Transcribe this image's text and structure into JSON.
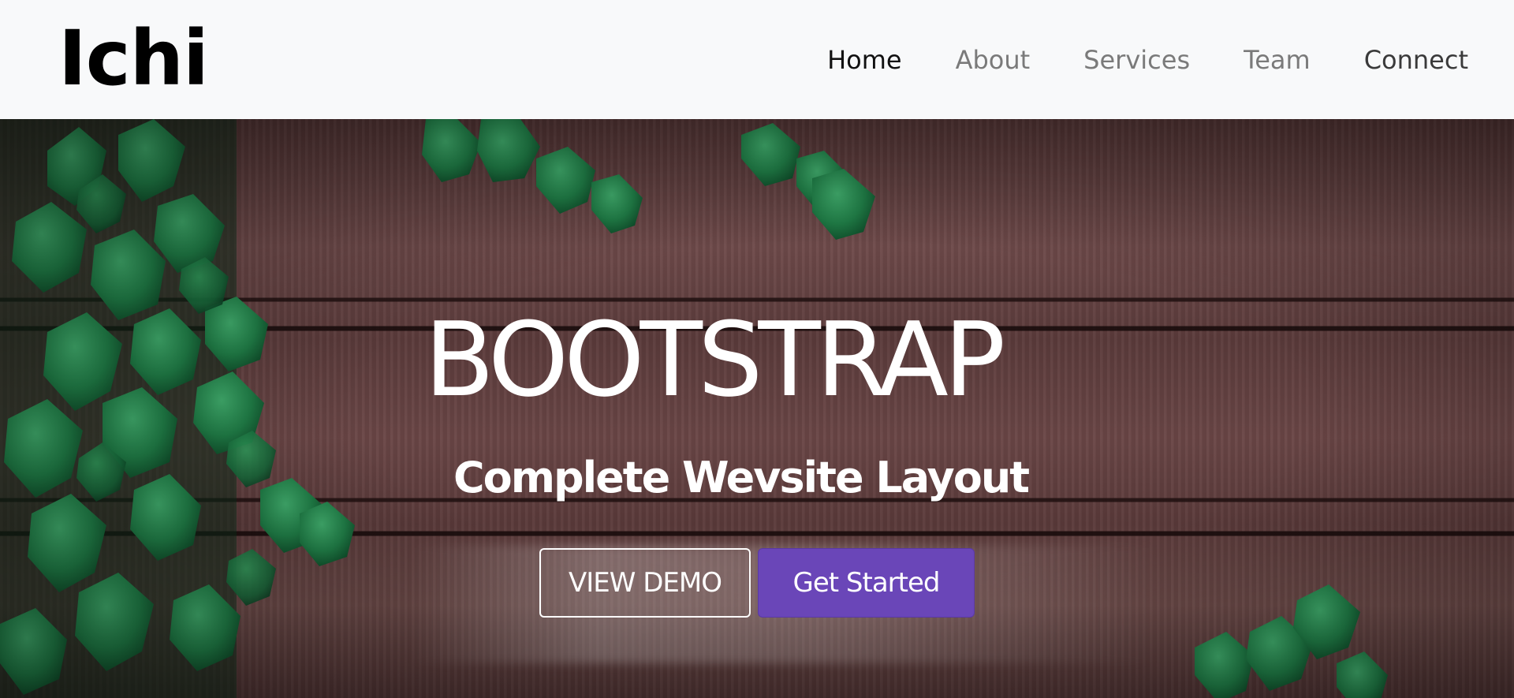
{
  "navbar": {
    "brand": "Ichi",
    "links": [
      {
        "label": "Home"
      },
      {
        "label": "About"
      },
      {
        "label": "Services"
      },
      {
        "label": "Team"
      },
      {
        "label": "Connect"
      }
    ]
  },
  "hero": {
    "title": "BOOTSTRAP",
    "subtitle": "Complete Wevsite Layout",
    "buttons": {
      "demo": "VIEW DEMO",
      "start": "Get Started"
    }
  },
  "colors": {
    "navbar_bg": "#f8f9fa",
    "primary_button": "#6a46b8",
    "text_light": "#ffffff",
    "nav_active": "#111111",
    "nav_inactive": "#7a7a7a"
  },
  "icons": {
    "background": "wooden-fence-with-ivy-image"
  }
}
